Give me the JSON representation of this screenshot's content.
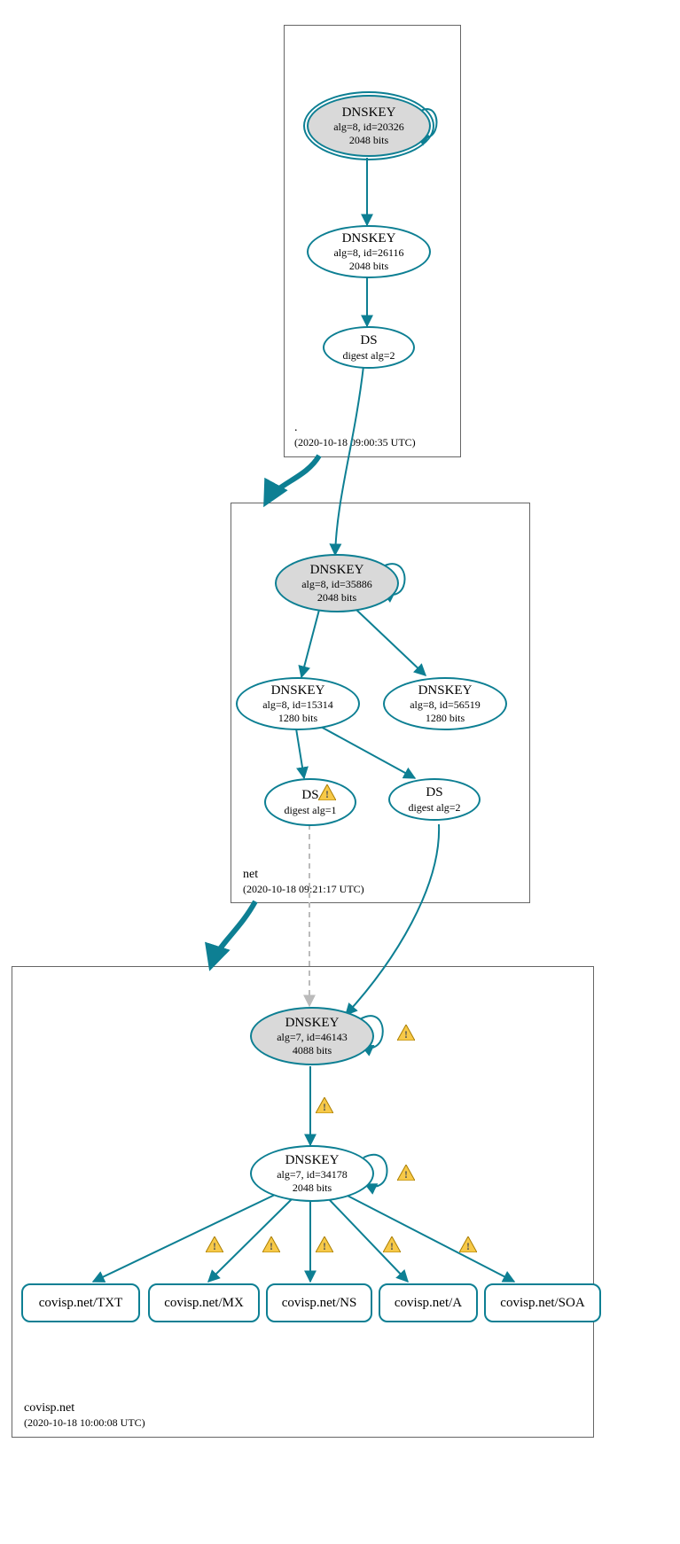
{
  "zones": {
    "root": {
      "name": ".",
      "timestamp": "(2020-10-18 09:00:35 UTC)"
    },
    "net": {
      "name": "net",
      "timestamp": "(2020-10-18 09:21:17 UTC)"
    },
    "covisp": {
      "name": "covisp.net",
      "timestamp": "(2020-10-18 10:00:08 UTC)"
    }
  },
  "nodes": {
    "root_ksk": {
      "title": "DNSKEY",
      "line2": "alg=8, id=20326",
      "line3": "2048 bits"
    },
    "root_zsk": {
      "title": "DNSKEY",
      "line2": "alg=8, id=26116",
      "line3": "2048 bits"
    },
    "root_ds": {
      "title": "DS",
      "line2": "digest alg=2"
    },
    "net_ksk": {
      "title": "DNSKEY",
      "line2": "alg=8, id=35886",
      "line3": "2048 bits"
    },
    "net_zsk1": {
      "title": "DNSKEY",
      "line2": "alg=8, id=15314",
      "line3": "1280 bits"
    },
    "net_zsk2": {
      "title": "DNSKEY",
      "line2": "alg=8, id=56519",
      "line3": "1280 bits"
    },
    "net_ds1": {
      "title": "DS",
      "line2": "digest alg=1"
    },
    "net_ds2": {
      "title": "DS",
      "line2": "digest alg=2"
    },
    "cov_ksk": {
      "title": "DNSKEY",
      "line2": "alg=7, id=46143",
      "line3": "4088 bits"
    },
    "cov_zsk": {
      "title": "DNSKEY",
      "line2": "alg=7, id=34178",
      "line3": "2048 bits"
    }
  },
  "rrsets": {
    "txt": "covisp.net/TXT",
    "mx": "covisp.net/MX",
    "ns": "covisp.net/NS",
    "a": "covisp.net/A",
    "soa": "covisp.net/SOA"
  }
}
